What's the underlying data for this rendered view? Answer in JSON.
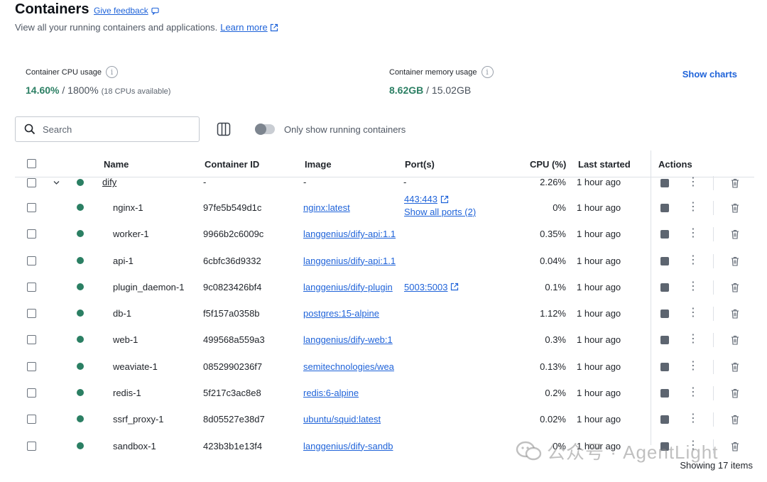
{
  "header": {
    "title": "Containers",
    "feedback_label": "Give feedback",
    "subtitle": "View all your running containers and applications.",
    "learn_more": "Learn more"
  },
  "stats": {
    "cpu_label": "Container CPU usage",
    "cpu_used": "14.60%",
    "cpu_total": "/ 1800%",
    "cpu_note": "(18 CPUs available)",
    "mem_label": "Container memory usage",
    "mem_used": "8.62GB",
    "mem_total": "/ 15.02GB",
    "show_charts": "Show charts"
  },
  "toolbar": {
    "search_placeholder": "Search",
    "toggle_label": "Only show running containers",
    "toggle_on": false
  },
  "table": {
    "headers": {
      "name": "Name",
      "container_id": "Container ID",
      "image": "Image",
      "ports": "Port(s)",
      "cpu": "CPU (%)",
      "last_started": "Last started",
      "actions": "Actions"
    },
    "group": {
      "name": "dify",
      "container_id": "-",
      "image": "-",
      "ports": "-",
      "cpu": "2.26%",
      "last_started": "1 hour ago"
    },
    "rows": [
      {
        "name": "nginx-1",
        "container_id": "97fe5b549d1c",
        "image": "nginx:latest",
        "port": "443:443",
        "port2": "Show all ports (2)",
        "cpu": "0%",
        "last_started": "1 hour ago"
      },
      {
        "name": "worker-1",
        "container_id": "9966b2c6009c",
        "image": "langgenius/dify-api:1.1",
        "port": "",
        "port2": "",
        "cpu": "0.35%",
        "last_started": "1 hour ago"
      },
      {
        "name": "api-1",
        "container_id": "6cbfc36d9332",
        "image": "langgenius/dify-api:1.1",
        "port": "",
        "port2": "",
        "cpu": "0.04%",
        "last_started": "1 hour ago"
      },
      {
        "name": "plugin_daemon-1",
        "container_id": "9c0823426bf4",
        "image": "langgenius/dify-plugin",
        "port": "5003:5003",
        "port2": "",
        "cpu": "0.1%",
        "last_started": "1 hour ago"
      },
      {
        "name": "db-1",
        "container_id": "f5f157a0358b",
        "image": "postgres:15-alpine",
        "port": "",
        "port2": "",
        "cpu": "1.12%",
        "last_started": "1 hour ago"
      },
      {
        "name": "web-1",
        "container_id": "499568a559a3",
        "image": "langgenius/dify-web:1",
        "port": "",
        "port2": "",
        "cpu": "0.3%",
        "last_started": "1 hour ago"
      },
      {
        "name": "weaviate-1",
        "container_id": "0852990236f7",
        "image": "semitechnologies/wea",
        "port": "",
        "port2": "",
        "cpu": "0.13%",
        "last_started": "1 hour ago"
      },
      {
        "name": "redis-1",
        "container_id": "5f217c3ac8e8",
        "image": "redis:6-alpine",
        "port": "",
        "port2": "",
        "cpu": "0.2%",
        "last_started": "1 hour ago"
      },
      {
        "name": "ssrf_proxy-1",
        "container_id": "8d05527e38d7",
        "image": "ubuntu/squid:latest",
        "port": "",
        "port2": "",
        "cpu": "0.02%",
        "last_started": "1 hour ago"
      },
      {
        "name": "sandbox-1",
        "container_id": "423b3b1e13f4",
        "image": "langgenius/dify-sandb",
        "port": "",
        "port2": "",
        "cpu": "0%",
        "last_started": "1 hour ago"
      }
    ]
  },
  "footer": {
    "showing": "Showing 17 items"
  },
  "watermark": {
    "text": "公众号 · AgentLight"
  },
  "colors": {
    "accent": "#1f63d9",
    "running": "#2b7f63"
  }
}
